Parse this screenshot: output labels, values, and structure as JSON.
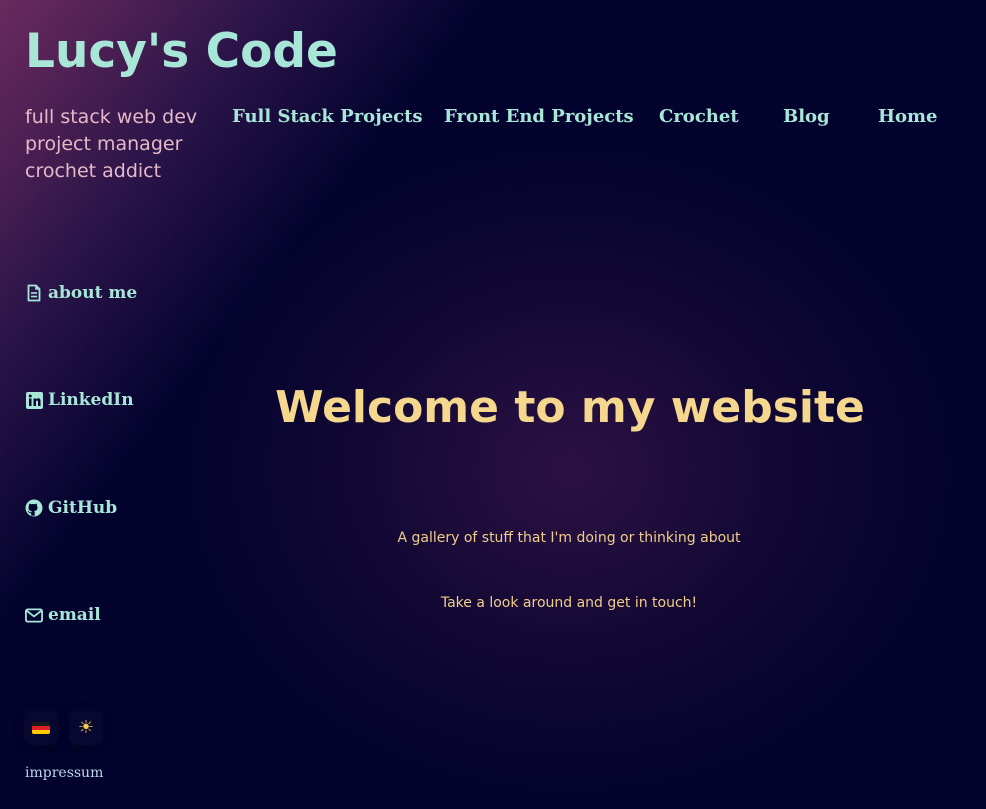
{
  "site": {
    "brand": "Lucy's Code",
    "taglines": [
      "full stack web dev",
      "project manager",
      "crochet addict"
    ]
  },
  "nav": {
    "items": [
      {
        "label": "Full Stack Projects"
      },
      {
        "label": "Front End Projects"
      },
      {
        "label": "Crochet"
      },
      {
        "label": "Blog"
      },
      {
        "label": "Home"
      }
    ]
  },
  "sidebar": {
    "links": [
      {
        "label": "about me",
        "icon": "file-text-icon"
      },
      {
        "label": "LinkedIn",
        "icon": "linkedin-icon"
      },
      {
        "label": "GitHub",
        "icon": "github-icon"
      },
      {
        "label": "email",
        "icon": "envelope-icon"
      }
    ],
    "toggles": {
      "language_icon": "german-flag-icon",
      "theme_icon": "sun-icon"
    },
    "impressum": "impressum"
  },
  "main": {
    "heading": "Welcome to my website",
    "paragraphs": [
      "A gallery of stuff that I'm doing or thinking about",
      "Take a look around and get in touch!"
    ]
  },
  "colors": {
    "background": "#03032e",
    "brand": "#a8e6d8",
    "nav": "#a8e6d8",
    "tagline": "#e6b9c9",
    "heading": "#f5d78e",
    "body_text": "#f0cd8a",
    "corner_glow": "#6a2a5e"
  }
}
